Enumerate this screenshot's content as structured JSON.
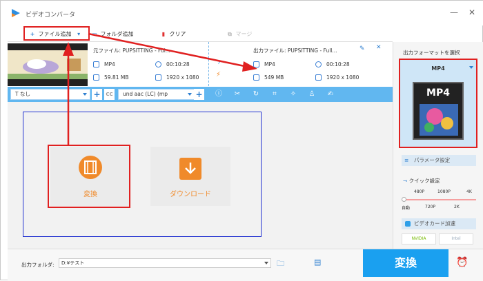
{
  "app": {
    "title": "ビデオコンバータ"
  },
  "toolbar": {
    "add_file_label": "ファイル追加",
    "add_folder_label": "フォルダ追加",
    "clear_label": "クリア",
    "merge_label": "マージ"
  },
  "file": {
    "source_label": "元ファイル: PUPSITTING - Ful...",
    "source_format": "MP4",
    "source_duration": "00:10:28",
    "source_size": "59.81 MB",
    "source_resolution": "1920 x 1080",
    "output_label": "出力ファイル: PUPSITTING - Full...",
    "output_format": "MP4",
    "output_duration": "00:10:28",
    "output_size": "549 MB",
    "output_resolution": "1920 x 1080"
  },
  "editbar": {
    "subtitle_value": "なし",
    "audio_value": "und aac (LC) (mp"
  },
  "cards": {
    "convert_label": "変換",
    "download_label": "ダウンロード"
  },
  "right_panel": {
    "output_format_title": "出力フォーマットを選択",
    "format_value": "MP4",
    "format_badge": "MP4",
    "param_settings_label": "パラメータ設定",
    "quick_settings_label": "クイック設定",
    "quality_top": [
      "480P",
      "1080P",
      "4K"
    ],
    "quality_bottom": [
      "自動",
      "720P",
      "2K"
    ],
    "gpu_accel_label": "ビデオカード加速",
    "nvidia_label": "NVIDIA",
    "intel_label": "Intel"
  },
  "bottom": {
    "output_folder_label": "出力フォルダ:",
    "output_folder_value": "D:¥テスト",
    "convert_button_label": "変換"
  },
  "colors": {
    "accent": "#1aa0f0",
    "highlight": "#e02020",
    "orange": "#f08a2a"
  }
}
